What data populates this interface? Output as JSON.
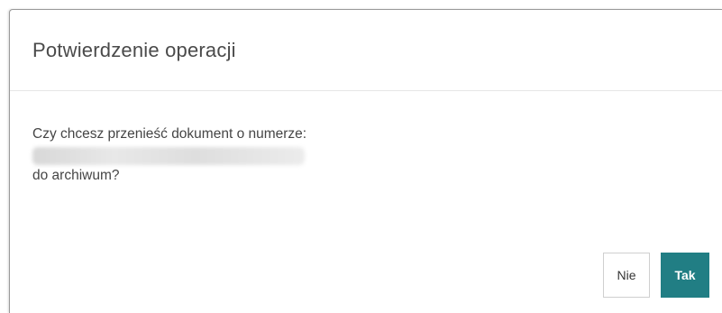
{
  "dialog": {
    "title": "Potwierdzenie operacji",
    "message_line1": "Czy chcesz przenieść dokument o numerze:",
    "document_number": "",
    "message_line3": "do archiwum?",
    "no_label": "Nie",
    "yes_label": "Tak"
  },
  "colors": {
    "accent": "#217e84",
    "title_text": "#4a4a4a",
    "body_text": "#454545"
  }
}
